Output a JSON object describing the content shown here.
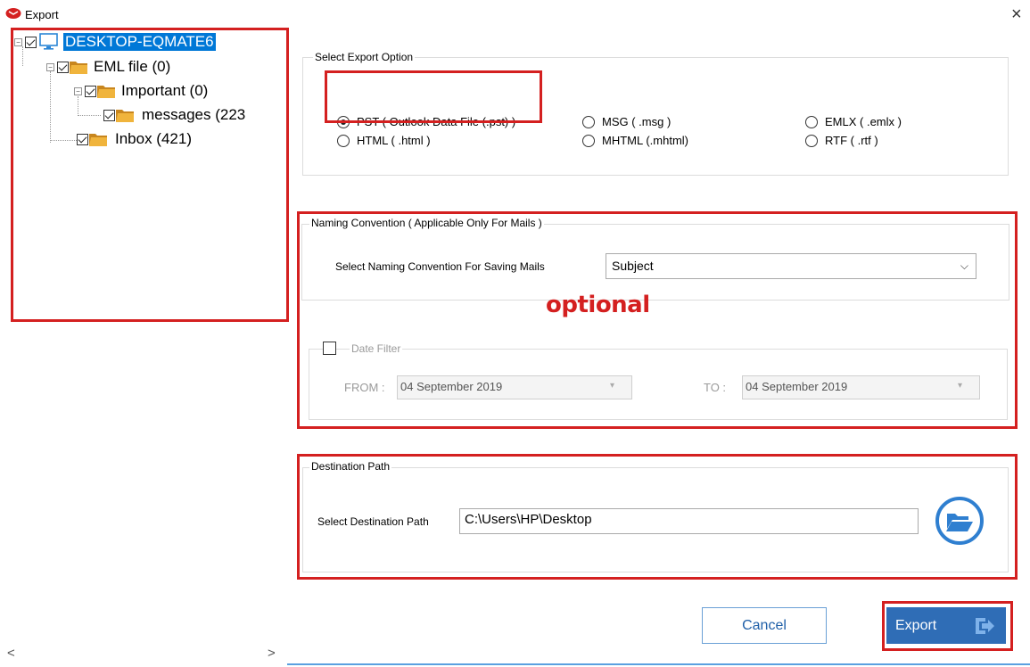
{
  "window": {
    "title": "Export",
    "close_glyph": "×"
  },
  "tree": {
    "root": {
      "label": "DESKTOP-EQMATE6",
      "checked": true,
      "icon": "computer-icon"
    },
    "eml": {
      "label": "EML file (0)",
      "checked": true,
      "icon": "folder-icon"
    },
    "important": {
      "label": "Important (0)",
      "checked": true,
      "icon": "folder-icon"
    },
    "messages": {
      "label": "messages (223",
      "checked": true,
      "icon": "folder-icon"
    },
    "inbox": {
      "label": "Inbox (421)",
      "checked": true,
      "icon": "folder-icon"
    }
  },
  "export_options": {
    "title": "Select Export Option",
    "options": [
      {
        "label": "PST ( Outlook Data File (.pst) )",
        "selected": true
      },
      {
        "label": "MSG  ( .msg )",
        "selected": false
      },
      {
        "label": "EMLX  ( .emlx )",
        "selected": false
      },
      {
        "label": "HTML  ( .html )",
        "selected": false
      },
      {
        "label": "MHTML  (.mhtml)",
        "selected": false
      },
      {
        "label": "RTF  ( .rtf )",
        "selected": false
      }
    ]
  },
  "naming": {
    "title": "Naming Convention ( Applicable Only For Mails )",
    "label": "Select Naming Convention For Saving Mails",
    "value": "Subject",
    "chevron": "⌵"
  },
  "annotation": {
    "optional": "optional"
  },
  "date_filter": {
    "label": "Date Filter",
    "checked": false,
    "from_label": "FROM :",
    "from_value": "04 September 2019",
    "to_label": "TO :",
    "to_value": "04 September 2019",
    "picker_glyph": "▾"
  },
  "destination": {
    "title": "Destination Path",
    "label": "Select Destination Path",
    "value": "C:\\Users\\HP\\Desktop",
    "browse_icon": "folder-open-icon"
  },
  "buttons": {
    "cancel": "Cancel",
    "export": "Export"
  },
  "scrollbar": {
    "left": "<",
    "right": ">"
  },
  "colors": {
    "highlight": "#d42020",
    "selection": "#0078d7",
    "export_button": "#2f6db6",
    "browse_icon": "#2f7fd0"
  }
}
